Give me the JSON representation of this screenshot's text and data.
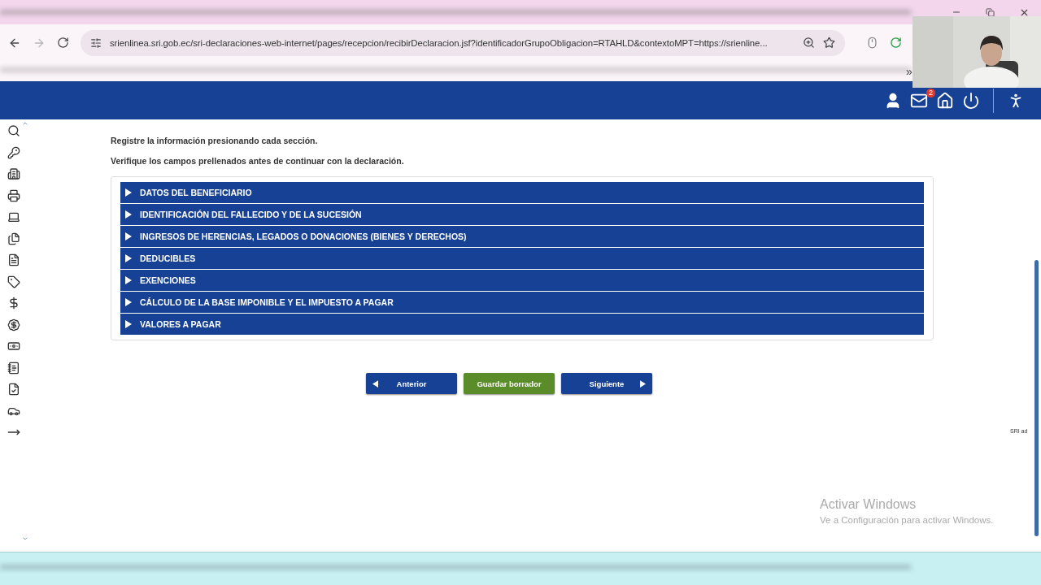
{
  "browser": {
    "url": "srienlinea.sri.gob.ec/sri-declaraciones-web-internet/pages/recepcion/recibirDeclaracion.jsf?identificadorGrupoObligacion=RTAHLD&contextoMPT=https://srienline...",
    "forward_disabled": true,
    "bookmarks_overflow": "»"
  },
  "header": {
    "mail_badge": "2"
  },
  "intro": [
    "Registre la información presionando cada sección.",
    "Verifique los campos prellenados antes de continuar con la declaración."
  ],
  "sections": [
    {
      "title": "DATOS DEL BENEFICIARIO",
      "expanded": false
    },
    {
      "title": "IDENTIFICACIÓN DEL FALLECIDO Y DE LA SUCESIÓN",
      "expanded": false
    },
    {
      "title": "INGRESOS DE HERENCIAS, LEGADOS O DONACIONES (BIENES Y DERECHOS)",
      "expanded": false
    },
    {
      "title": "DEDUCIBLES",
      "expanded": false
    },
    {
      "title": "EXENCIONES",
      "expanded": false
    },
    {
      "title": "CÁLCULO DE LA BASE IMPONIBLE Y EL IMPUESTO A PAGAR",
      "expanded": false
    },
    {
      "title": "VALORES A PAGAR",
      "expanded": false
    }
  ],
  "buttons": [
    {
      "label": "Anterior",
      "kind": "prev"
    },
    {
      "label": "Guardar borrador",
      "kind": "save"
    },
    {
      "label": "Siguiente",
      "kind": "next"
    }
  ],
  "side_note": "SRI ad",
  "activation": {
    "title": "Activar Windows",
    "text": "Ve a Configuración para activar Windows."
  }
}
